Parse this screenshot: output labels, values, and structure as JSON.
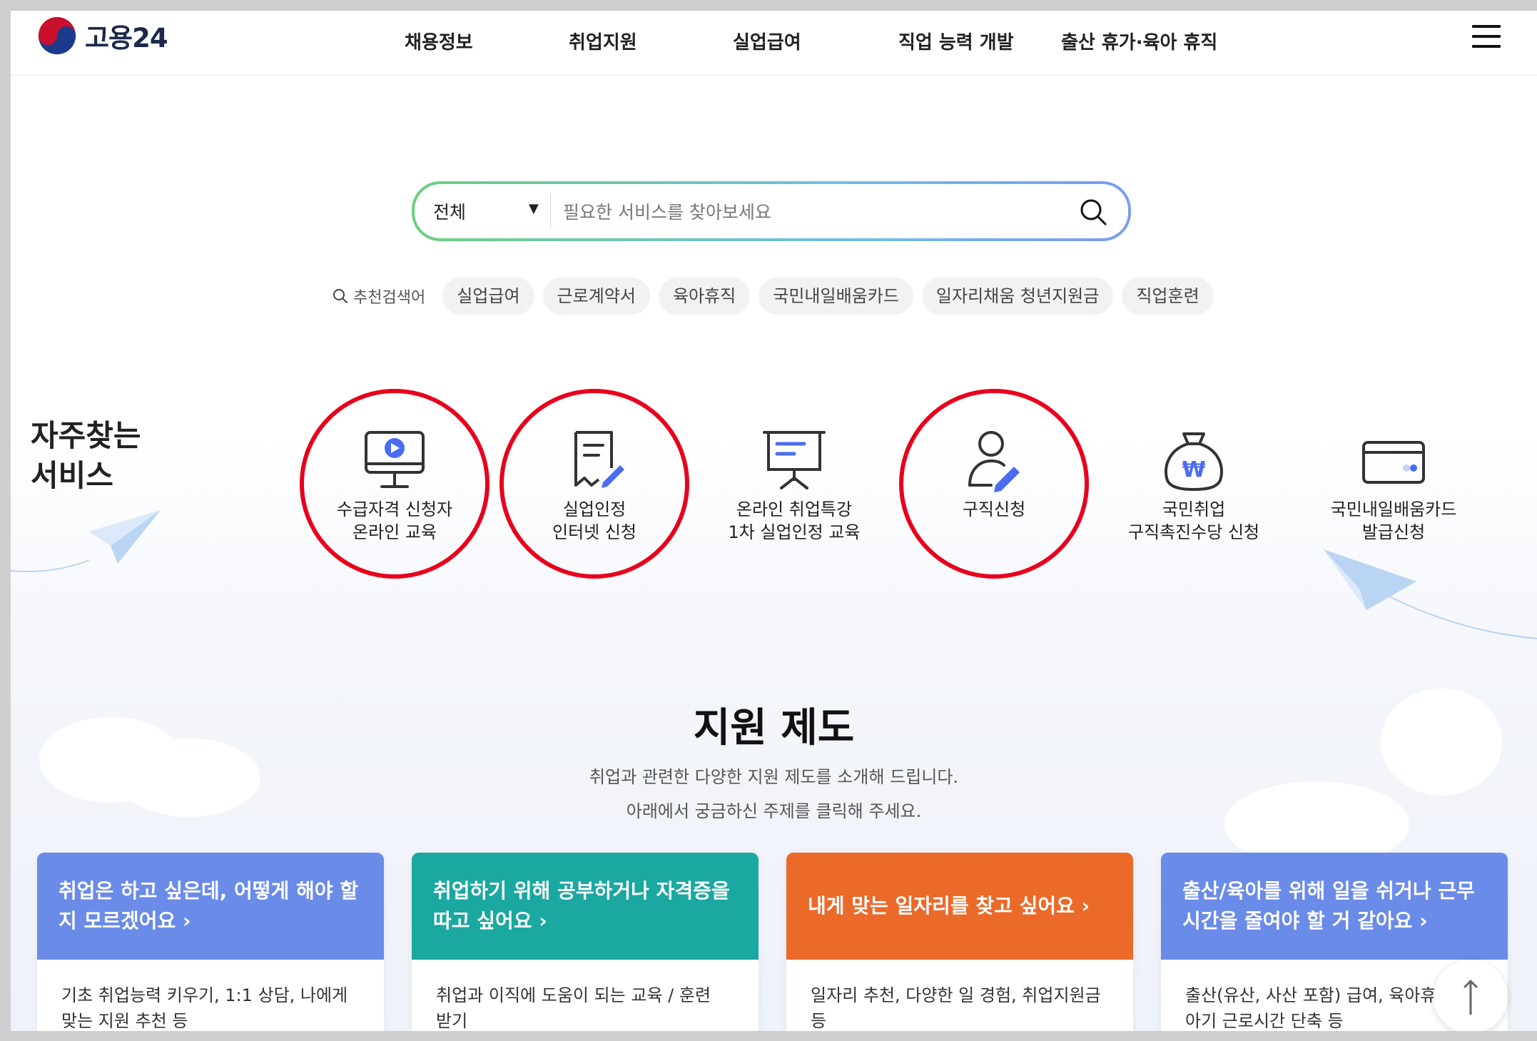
{
  "header": {
    "logo_text": "고용24",
    "nav": [
      "채용정보",
      "취업지원",
      "실업급여",
      "직업 능력 개발",
      "출산 휴가·육아 휴직"
    ]
  },
  "search": {
    "category": "전체",
    "placeholder": "필요한 서비스를 찾아보세요",
    "value": ""
  },
  "keywords": {
    "label": "추천검색어",
    "items": [
      "실업급여",
      "근로계약서",
      "육아휴직",
      "국민내일배움카드",
      "일자리채움 청년지원금",
      "직업훈련"
    ]
  },
  "frequent": {
    "title_line1": "자주찾는",
    "title_line2": "서비스",
    "items": [
      {
        "line1": "수급자격 신청자",
        "line2": "온라인 교육",
        "icon": "monitor-play-icon",
        "circled": true
      },
      {
        "line1": "실업인정",
        "line2": "인터넷 신청",
        "icon": "document-pen-icon",
        "circled": true
      },
      {
        "line1": "온라인 취업특강",
        "line2": "1차 실업인정 교육",
        "icon": "presentation-board-icon",
        "circled": false
      },
      {
        "line1": "구직신청",
        "line2": "",
        "icon": "person-pen-icon",
        "circled": true
      },
      {
        "line1": "국민취업",
        "line2": "구직촉진수당 신청",
        "icon": "money-bag-won-icon",
        "circled": false
      },
      {
        "line1": "국민내일배움카드",
        "line2": "발급신청",
        "icon": "card-icon",
        "circled": false
      }
    ]
  },
  "support": {
    "title": "지원 제도",
    "desc1": "취업과 관련한 다양한 지원 제도를 소개해 드립니다.",
    "desc2": "아래에서 궁금하신 주제를 클릭해 주세요.",
    "cards": [
      {
        "head1": "취업은 하고 싶은데, 어떻게 해야 할",
        "head2": "지 모르겠어요  ›",
        "body1": "기초 취업능력 키우기, 1:1 상담, 나에게",
        "body2": "맞는 지원 추천 등",
        "color": "#6b8be8"
      },
      {
        "head1": "취업하기 위해 공부하거나 자격증을",
        "head2": "따고 싶어요  ›",
        "body1": "취업과 이직에 도움이 되는 교육 / 훈련",
        "body2": "받기",
        "color": "#1aa8a0"
      },
      {
        "head1": "내게 맞는 일자리를 찾고 싶어요  ›",
        "head2": "",
        "body1": "일자리 추천, 다양한 일 경험, 취업지원금",
        "body2": "등",
        "color": "#eb6a2a"
      },
      {
        "head1": "출산/육아를 위해 일을 쉬거나 근무",
        "head2": "시간을 줄여야 할 거 같아요  ›",
        "body1": "출산(유산, 사산 포함) 급여, 육아휴",
        "body2": "아기 근로시간 단축 등",
        "color": "#6b8be8"
      }
    ]
  }
}
